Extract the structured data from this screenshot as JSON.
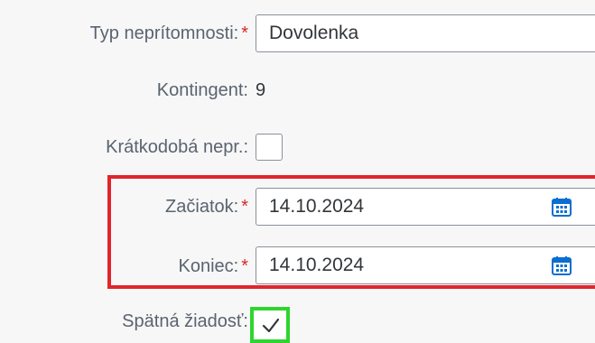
{
  "form": {
    "absence_type": {
      "label": "Typ neprítomnosti:",
      "required_mark": "*",
      "value": "Dovolenka"
    },
    "quota": {
      "label": "Kontingent:",
      "value": "9"
    },
    "short_absence": {
      "label": "Krátkodobá nepr.:",
      "checked": false
    },
    "start_date": {
      "label": "Začiatok:",
      "required_mark": "*",
      "value": "14.10.2024",
      "icon": "calendar-icon"
    },
    "end_date": {
      "label": "Koniec:",
      "required_mark": "*",
      "value": "14.10.2024",
      "icon": "calendar-icon"
    },
    "retro_request": {
      "label": "Spätná žiadosť:",
      "checked": true
    }
  },
  "highlights": {
    "date_frame_color": "#e0252d",
    "checkbox_frame_color": "#2fd42f"
  },
  "colors": {
    "accent": "#0a6ed1",
    "required": "#d8262c",
    "label": "#5a6370"
  }
}
